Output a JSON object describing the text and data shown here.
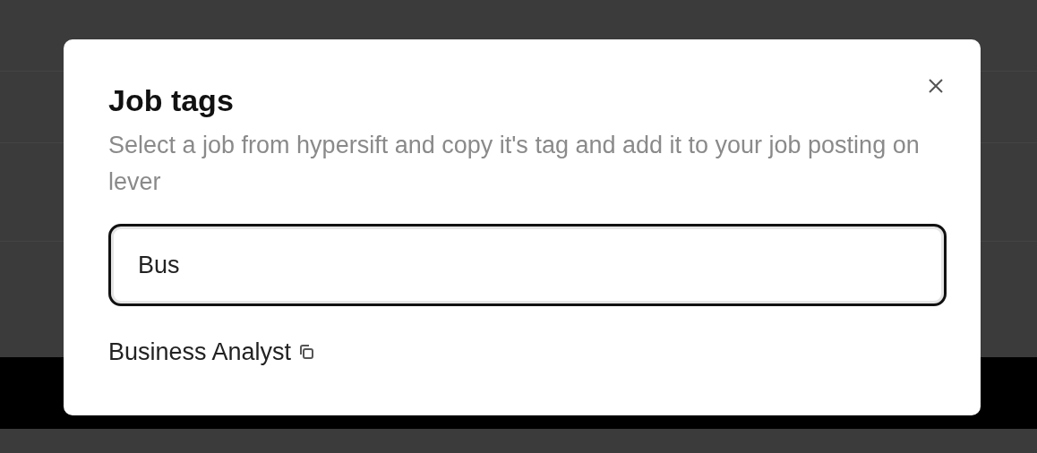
{
  "dialog": {
    "title": "Job tags",
    "description": "Select a job from hypersift and copy it's tag and add it to your job posting on lever",
    "search": {
      "value": "Bus",
      "focused": true
    },
    "results": [
      {
        "label": "Business Analyst"
      }
    ]
  }
}
